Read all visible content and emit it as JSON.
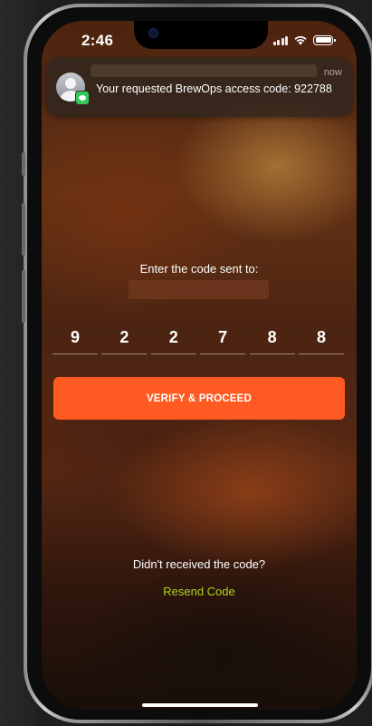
{
  "status_bar": {
    "time": "2:46"
  },
  "notification": {
    "time": "now",
    "message": "Your requested BrewOps access code:  922788",
    "app_icon": "messages-icon",
    "avatar_icon": "contact-avatar-icon"
  },
  "verification": {
    "prompt": "Enter the code sent to:",
    "code_digits": [
      "9",
      "2",
      "2",
      "7",
      "8",
      "8"
    ],
    "verify_label": "VERIFY & PROCEED",
    "no_code_text": "Didn't received the code?",
    "resend_label": "Resend Code"
  },
  "colors": {
    "accent": "#ff5a22",
    "resend_link": "#b3d21c"
  }
}
